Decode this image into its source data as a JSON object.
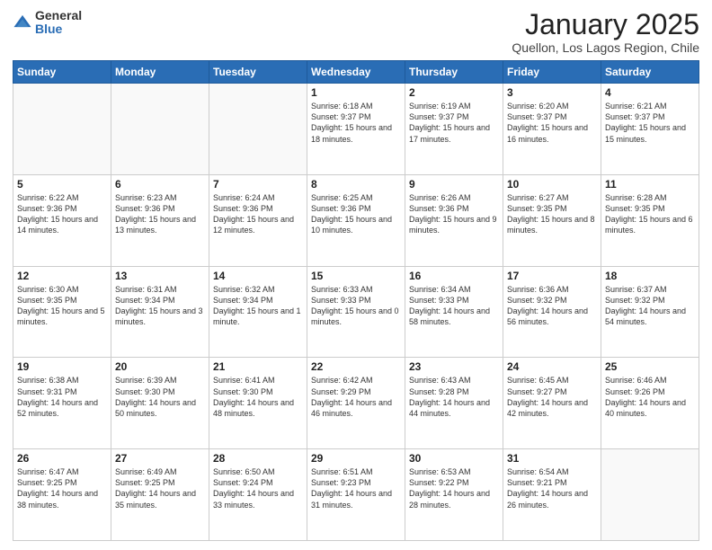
{
  "logo": {
    "general": "General",
    "blue": "Blue"
  },
  "title": {
    "month": "January 2025",
    "location": "Quellon, Los Lagos Region, Chile"
  },
  "days_of_week": [
    "Sunday",
    "Monday",
    "Tuesday",
    "Wednesday",
    "Thursday",
    "Friday",
    "Saturday"
  ],
  "weeks": [
    [
      {
        "day": "",
        "text": ""
      },
      {
        "day": "",
        "text": ""
      },
      {
        "day": "",
        "text": ""
      },
      {
        "day": "1",
        "text": "Sunrise: 6:18 AM\nSunset: 9:37 PM\nDaylight: 15 hours and 18 minutes."
      },
      {
        "day": "2",
        "text": "Sunrise: 6:19 AM\nSunset: 9:37 PM\nDaylight: 15 hours and 17 minutes."
      },
      {
        "day": "3",
        "text": "Sunrise: 6:20 AM\nSunset: 9:37 PM\nDaylight: 15 hours and 16 minutes."
      },
      {
        "day": "4",
        "text": "Sunrise: 6:21 AM\nSunset: 9:37 PM\nDaylight: 15 hours and 15 minutes."
      }
    ],
    [
      {
        "day": "5",
        "text": "Sunrise: 6:22 AM\nSunset: 9:36 PM\nDaylight: 15 hours and 14 minutes."
      },
      {
        "day": "6",
        "text": "Sunrise: 6:23 AM\nSunset: 9:36 PM\nDaylight: 15 hours and 13 minutes."
      },
      {
        "day": "7",
        "text": "Sunrise: 6:24 AM\nSunset: 9:36 PM\nDaylight: 15 hours and 12 minutes."
      },
      {
        "day": "8",
        "text": "Sunrise: 6:25 AM\nSunset: 9:36 PM\nDaylight: 15 hours and 10 minutes."
      },
      {
        "day": "9",
        "text": "Sunrise: 6:26 AM\nSunset: 9:36 PM\nDaylight: 15 hours and 9 minutes."
      },
      {
        "day": "10",
        "text": "Sunrise: 6:27 AM\nSunset: 9:35 PM\nDaylight: 15 hours and 8 minutes."
      },
      {
        "day": "11",
        "text": "Sunrise: 6:28 AM\nSunset: 9:35 PM\nDaylight: 15 hours and 6 minutes."
      }
    ],
    [
      {
        "day": "12",
        "text": "Sunrise: 6:30 AM\nSunset: 9:35 PM\nDaylight: 15 hours and 5 minutes."
      },
      {
        "day": "13",
        "text": "Sunrise: 6:31 AM\nSunset: 9:34 PM\nDaylight: 15 hours and 3 minutes."
      },
      {
        "day": "14",
        "text": "Sunrise: 6:32 AM\nSunset: 9:34 PM\nDaylight: 15 hours and 1 minute."
      },
      {
        "day": "15",
        "text": "Sunrise: 6:33 AM\nSunset: 9:33 PM\nDaylight: 15 hours and 0 minutes."
      },
      {
        "day": "16",
        "text": "Sunrise: 6:34 AM\nSunset: 9:33 PM\nDaylight: 14 hours and 58 minutes."
      },
      {
        "day": "17",
        "text": "Sunrise: 6:36 AM\nSunset: 9:32 PM\nDaylight: 14 hours and 56 minutes."
      },
      {
        "day": "18",
        "text": "Sunrise: 6:37 AM\nSunset: 9:32 PM\nDaylight: 14 hours and 54 minutes."
      }
    ],
    [
      {
        "day": "19",
        "text": "Sunrise: 6:38 AM\nSunset: 9:31 PM\nDaylight: 14 hours and 52 minutes."
      },
      {
        "day": "20",
        "text": "Sunrise: 6:39 AM\nSunset: 9:30 PM\nDaylight: 14 hours and 50 minutes."
      },
      {
        "day": "21",
        "text": "Sunrise: 6:41 AM\nSunset: 9:30 PM\nDaylight: 14 hours and 48 minutes."
      },
      {
        "day": "22",
        "text": "Sunrise: 6:42 AM\nSunset: 9:29 PM\nDaylight: 14 hours and 46 minutes."
      },
      {
        "day": "23",
        "text": "Sunrise: 6:43 AM\nSunset: 9:28 PM\nDaylight: 14 hours and 44 minutes."
      },
      {
        "day": "24",
        "text": "Sunrise: 6:45 AM\nSunset: 9:27 PM\nDaylight: 14 hours and 42 minutes."
      },
      {
        "day": "25",
        "text": "Sunrise: 6:46 AM\nSunset: 9:26 PM\nDaylight: 14 hours and 40 minutes."
      }
    ],
    [
      {
        "day": "26",
        "text": "Sunrise: 6:47 AM\nSunset: 9:25 PM\nDaylight: 14 hours and 38 minutes."
      },
      {
        "day": "27",
        "text": "Sunrise: 6:49 AM\nSunset: 9:25 PM\nDaylight: 14 hours and 35 minutes."
      },
      {
        "day": "28",
        "text": "Sunrise: 6:50 AM\nSunset: 9:24 PM\nDaylight: 14 hours and 33 minutes."
      },
      {
        "day": "29",
        "text": "Sunrise: 6:51 AM\nSunset: 9:23 PM\nDaylight: 14 hours and 31 minutes."
      },
      {
        "day": "30",
        "text": "Sunrise: 6:53 AM\nSunset: 9:22 PM\nDaylight: 14 hours and 28 minutes."
      },
      {
        "day": "31",
        "text": "Sunrise: 6:54 AM\nSunset: 9:21 PM\nDaylight: 14 hours and 26 minutes."
      },
      {
        "day": "",
        "text": ""
      }
    ]
  ]
}
